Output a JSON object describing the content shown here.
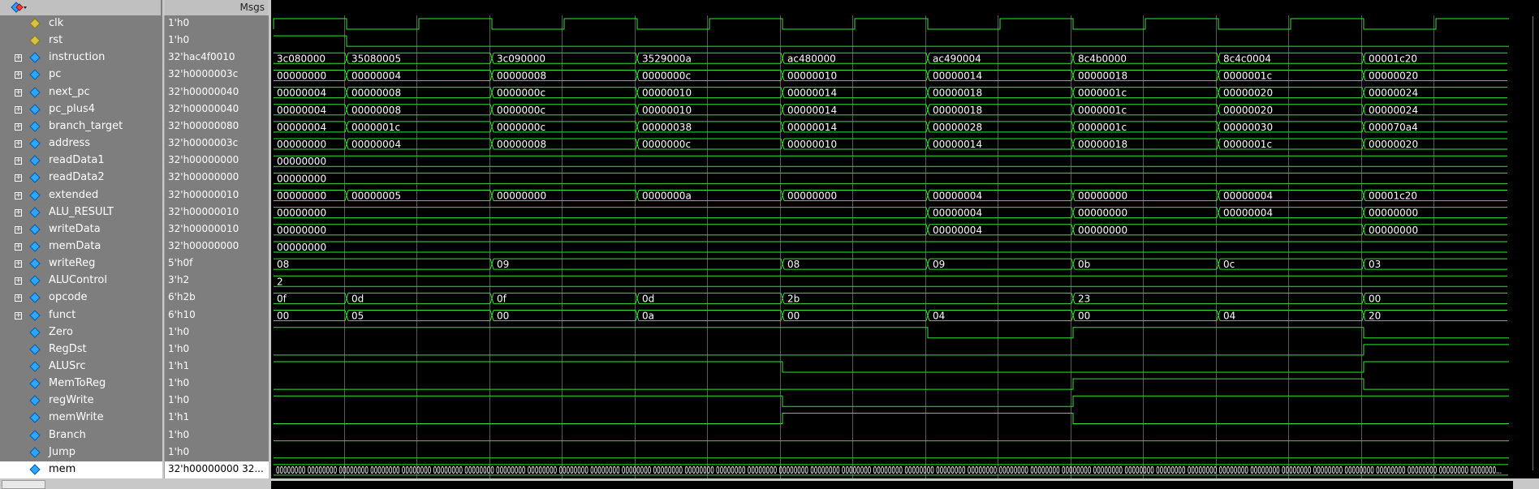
{
  "header": {
    "msgs_label": "Msgs"
  },
  "signals": [
    {
      "name": "clk",
      "value": "1'h0",
      "kind": "clock",
      "expandable": false
    },
    {
      "name": "rst",
      "value": "1'h0",
      "kind": "bit",
      "expandable": false
    },
    {
      "name": "instruction",
      "value": "32'hac4f0010",
      "kind": "bus",
      "expandable": true
    },
    {
      "name": "pc",
      "value": "32'h0000003c",
      "kind": "bus",
      "expandable": true
    },
    {
      "name": "next_pc",
      "value": "32'h00000040",
      "kind": "bus",
      "expandable": true
    },
    {
      "name": "pc_plus4",
      "value": "32'h00000040",
      "kind": "bus",
      "expandable": true
    },
    {
      "name": "branch_target",
      "value": "32'h00000080",
      "kind": "bus",
      "expandable": true
    },
    {
      "name": "address",
      "value": "32'h0000003c",
      "kind": "bus",
      "expandable": true
    },
    {
      "name": "readData1",
      "value": "32'h00000000",
      "kind": "bus",
      "expandable": true
    },
    {
      "name": "readData2",
      "value": "32'h00000000",
      "kind": "bus",
      "expandable": true
    },
    {
      "name": "extended",
      "value": "32'h00000010",
      "kind": "bus",
      "expandable": true
    },
    {
      "name": "ALU_RESULT",
      "value": "32'h00000010",
      "kind": "bus",
      "expandable": true
    },
    {
      "name": "writeData",
      "value": "32'h00000010",
      "kind": "bus",
      "expandable": true
    },
    {
      "name": "memData",
      "value": "32'h00000000",
      "kind": "bus",
      "expandable": true
    },
    {
      "name": "writeReg",
      "value": "5'h0f",
      "kind": "bus",
      "expandable": true
    },
    {
      "name": "ALUControl",
      "value": "3'h2",
      "kind": "bus",
      "expandable": true
    },
    {
      "name": "opcode",
      "value": "6'h2b",
      "kind": "bus",
      "expandable": true
    },
    {
      "name": "funct",
      "value": "6'h10",
      "kind": "bus",
      "expandable": true
    },
    {
      "name": "Zero",
      "value": "1'h0",
      "kind": "bit",
      "expandable": false
    },
    {
      "name": "RegDst",
      "value": "1'h0",
      "kind": "bit",
      "expandable": false
    },
    {
      "name": "ALUSrc",
      "value": "1'h1",
      "kind": "bit",
      "expandable": false
    },
    {
      "name": "MemToReg",
      "value": "1'h0",
      "kind": "bit",
      "expandable": false
    },
    {
      "name": "regWrite",
      "value": "1'h0",
      "kind": "bit",
      "expandable": false
    },
    {
      "name": "memWrite",
      "value": "1'h1",
      "kind": "bit",
      "expandable": false
    },
    {
      "name": "Branch",
      "value": "1'h0",
      "kind": "bit",
      "expandable": false
    },
    {
      "name": "Jump",
      "value": "1'h0",
      "kind": "bit",
      "expandable": false
    },
    {
      "name": "mem",
      "value": "32'h00000000 32...",
      "kind": "mem",
      "expandable": true
    }
  ],
  "waves": {
    "instruction": {
      "t": [
        0,
        1,
        3,
        5,
        7,
        9,
        11,
        13,
        15
      ],
      "v": [
        "3c080000",
        "35080005",
        "3c090000",
        "3529000a",
        "ac480000",
        "ac490004",
        "8c4b0000",
        "8c4c0004",
        "00001c20"
      ]
    },
    "pc": {
      "t": [
        0,
        1,
        3,
        5,
        7,
        9,
        11,
        13,
        15
      ],
      "v": [
        "00000000",
        "00000004",
        "00000008",
        "0000000c",
        "00000010",
        "00000014",
        "00000018",
        "0000001c",
        "00000020"
      ]
    },
    "next_pc": {
      "t": [
        0,
        1,
        3,
        5,
        7,
        9,
        11,
        13,
        15
      ],
      "v": [
        "00000004",
        "00000008",
        "0000000c",
        "00000010",
        "00000014",
        "00000018",
        "0000001c",
        "00000020",
        "00000024"
      ]
    },
    "pc_plus4": {
      "t": [
        0,
        1,
        3,
        5,
        7,
        9,
        11,
        13,
        15
      ],
      "v": [
        "00000004",
        "00000008",
        "0000000c",
        "00000010",
        "00000014",
        "00000018",
        "0000001c",
        "00000020",
        "00000024"
      ]
    },
    "branch_target": {
      "t": [
        0,
        1,
        3,
        5,
        7,
        9,
        11,
        13,
        15
      ],
      "v": [
        "00000004",
        "0000001c",
        "0000000c",
        "00000038",
        "00000014",
        "00000028",
        "0000001c",
        "00000030",
        "000070a4"
      ]
    },
    "address": {
      "t": [
        0,
        1,
        3,
        5,
        7,
        9,
        11,
        13,
        15
      ],
      "v": [
        "00000000",
        "00000004",
        "00000008",
        "0000000c",
        "00000010",
        "00000014",
        "00000018",
        "0000001c",
        "00000020"
      ]
    },
    "readData1": {
      "t": [
        0
      ],
      "v": [
        "00000000"
      ]
    },
    "readData2": {
      "t": [
        0
      ],
      "v": [
        "00000000"
      ]
    },
    "extended": {
      "t": [
        0,
        1,
        3,
        5,
        7,
        9,
        11,
        13,
        15
      ],
      "v": [
        "00000000",
        "00000005",
        "00000000",
        "0000000a",
        "00000000",
        "00000004",
        "00000000",
        "00000004",
        "00001c20"
      ]
    },
    "ALU_RESULT": {
      "t": [
        0,
        9,
        11,
        13,
        15
      ],
      "v": [
        "00000000",
        "00000004",
        "00000000",
        "00000004",
        "00000000"
      ]
    },
    "writeData": {
      "t": [
        0,
        9,
        11,
        15
      ],
      "v": [
        "00000000",
        "00000004",
        "00000000",
        "00000000"
      ]
    },
    "memData": {
      "t": [
        0
      ],
      "v": [
        "00000000"
      ]
    },
    "writeReg": {
      "t": [
        0,
        3,
        7,
        9,
        11,
        13,
        15
      ],
      "v": [
        "08",
        "09",
        "08",
        "09",
        "0b",
        "0c",
        "03"
      ]
    },
    "ALUControl": {
      "t": [
        0
      ],
      "v": [
        "2"
      ]
    },
    "opcode": {
      "t": [
        0,
        1,
        3,
        5,
        7,
        11,
        15
      ],
      "v": [
        "0f",
        "0d",
        "0f",
        "0d",
        "2b",
        "23",
        "00"
      ]
    },
    "funct": {
      "t": [
        0,
        1,
        3,
        5,
        7,
        9,
        11,
        13,
        15
      ],
      "v": [
        "00",
        "05",
        "00",
        "0a",
        "00",
        "04",
        "00",
        "04",
        "20"
      ]
    },
    "Zero": {
      "levels": [
        1,
        1,
        1,
        1,
        1,
        1,
        1,
        1,
        1,
        0,
        0,
        1,
        1,
        1,
        1,
        0,
        0
      ]
    },
    "RegDst": {
      "levels": [
        0,
        0,
        0,
        0,
        0,
        0,
        0,
        0,
        0,
        0,
        0,
        0,
        0,
        0,
        0,
        1,
        1
      ]
    },
    "ALUSrc": {
      "levels": [
        1,
        1,
        1,
        1,
        1,
        1,
        1,
        0,
        0,
        0,
        0,
        0,
        0,
        0,
        0,
        1,
        1
      ]
    },
    "MemToReg": {
      "levels": [
        0,
        0,
        0,
        0,
        0,
        0,
        0,
        0,
        0,
        0,
        0,
        1,
        1,
        1,
        1,
        0,
        0
      ]
    },
    "regWrite": {
      "levels": [
        1,
        1,
        1,
        1,
        1,
        1,
        1,
        0,
        0,
        0,
        0,
        1,
        1,
        1,
        1,
        1,
        1
      ]
    },
    "memWrite": {
      "levels": [
        0,
        0,
        0,
        0,
        0,
        0,
        0,
        1,
        1,
        1,
        1,
        0,
        0,
        0,
        0,
        0,
        0
      ]
    },
    "Branch": {
      "levels": [
        0,
        0,
        0,
        0,
        0,
        0,
        0,
        0,
        0,
        0,
        0,
        0,
        0,
        0,
        0,
        0,
        0
      ]
    },
    "Jump": {
      "levels": [
        0,
        0,
        0,
        0,
        0,
        0,
        0,
        0,
        0,
        0,
        0,
        0,
        0,
        0,
        0,
        0,
        0
      ]
    },
    "rst": {
      "levels": [
        1,
        0,
        0,
        0,
        0,
        0,
        0,
        0,
        0,
        0,
        0,
        0,
        0,
        0,
        0,
        0,
        0
      ]
    },
    "mem": {
      "text": "00000000 00000000 00000000 00000000 00000000 00000000 00000000 00000000 00000000 00000000 00000000 00000000 00000000 00000000 00000000 00000000 00000000 00000000 00000000 00000000 00000000 00000000 00000000 00000000 00000000 00000000 00000000 00000000 00000000 00000000 00000000 00000000 00000000 00000000 00000000 00000000 00000000 00000000 0000000..."
    }
  },
  "colors": {
    "wave": "#2ee62e",
    "grid": "#5a5a5a",
    "text": "#ffffff",
    "names_bg": "#7e7e7e"
  },
  "icons": {
    "tool": "modelsim-wave-icon",
    "signal": "signal-diamond-icon",
    "expand": "expand-plus-icon"
  }
}
